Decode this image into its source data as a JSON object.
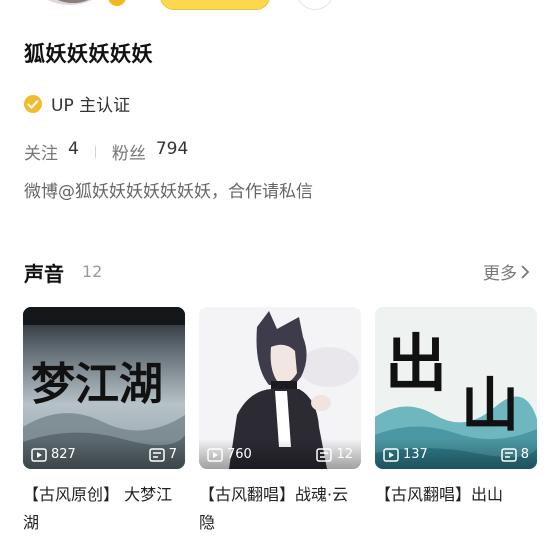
{
  "profile": {
    "name": "狐妖妖妖妖妖",
    "verify_text": "UP 主认证",
    "following_label": "关注",
    "following_count": "4",
    "fans_label": "粉丝",
    "fans_count": "794",
    "bio": "微博@狐妖妖妖妖妖妖妖，合作请私信"
  },
  "section": {
    "title": "声音",
    "count": "12",
    "more_label": "更多"
  },
  "cards": [
    {
      "title": "【古风原创】 大梦江湖",
      "plays": "827",
      "parts": "7",
      "art_text": "梦江湖"
    },
    {
      "title": "【古风翻唱】战魂·云隐",
      "plays": "760",
      "parts": "12"
    },
    {
      "title": "【古风翻唱】出山",
      "plays": "137",
      "parts": "8",
      "art_text": "出山"
    }
  ],
  "icons": {
    "verify": "verified-check-icon",
    "play": "play-icon",
    "parts": "playlist-icon",
    "more": "chevron-right-icon"
  },
  "colors": {
    "accent": "#ffd84f",
    "verify_gold": "#f0bc2d"
  }
}
